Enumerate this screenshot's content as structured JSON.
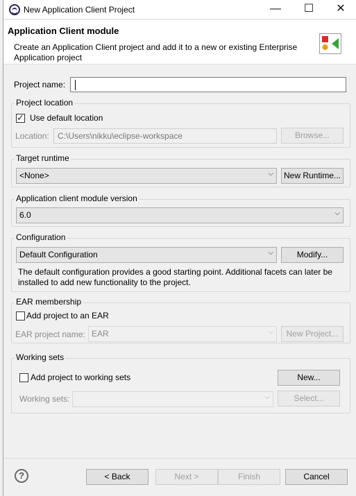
{
  "window": {
    "title": "New Application Client Project",
    "minimize_glyph": "—",
    "maximize_glyph": "☐",
    "close_glyph": "✕"
  },
  "header": {
    "title": "Application Client module",
    "description": "Create an Application Client project and add it to a new or existing Enterprise Application project",
    "icon": "wizard-banner-icon"
  },
  "project_name": {
    "label": "Project name:",
    "value": ""
  },
  "project_location": {
    "group_title": "Project location",
    "use_default_label": "Use default location",
    "use_default_checked": true,
    "location_label": "Location:",
    "location_value": "C:\\Users\\nikku\\eclipse-workspace",
    "browse_label": "Browse..."
  },
  "target_runtime": {
    "group_title": "Target runtime",
    "selected": "<None>",
    "new_runtime_label": "New Runtime..."
  },
  "module_version": {
    "group_title": "Application client module version",
    "selected": "6.0"
  },
  "configuration": {
    "group_title": "Configuration",
    "selected": "Default Configuration",
    "modify_label": "Modify...",
    "description": "The default configuration provides a good starting point. Additional facets can later be installed to add new functionality to the project."
  },
  "ear_membership": {
    "group_title": "EAR membership",
    "add_label": "Add project to an EAR",
    "add_checked": false,
    "ear_project_label": "EAR project name:",
    "ear_project_value": "EAR",
    "new_project_label": "New Project..."
  },
  "working_sets": {
    "group_title": "Working sets",
    "add_label": "Add project to working sets",
    "add_checked": false,
    "new_label": "New...",
    "working_sets_label": "Working sets:",
    "working_sets_value": "",
    "select_label": "Select..."
  },
  "footer": {
    "help_glyph": "?",
    "back_label": "< Back",
    "next_label": "Next >",
    "finish_label": "Finish",
    "cancel_label": "Cancel"
  }
}
